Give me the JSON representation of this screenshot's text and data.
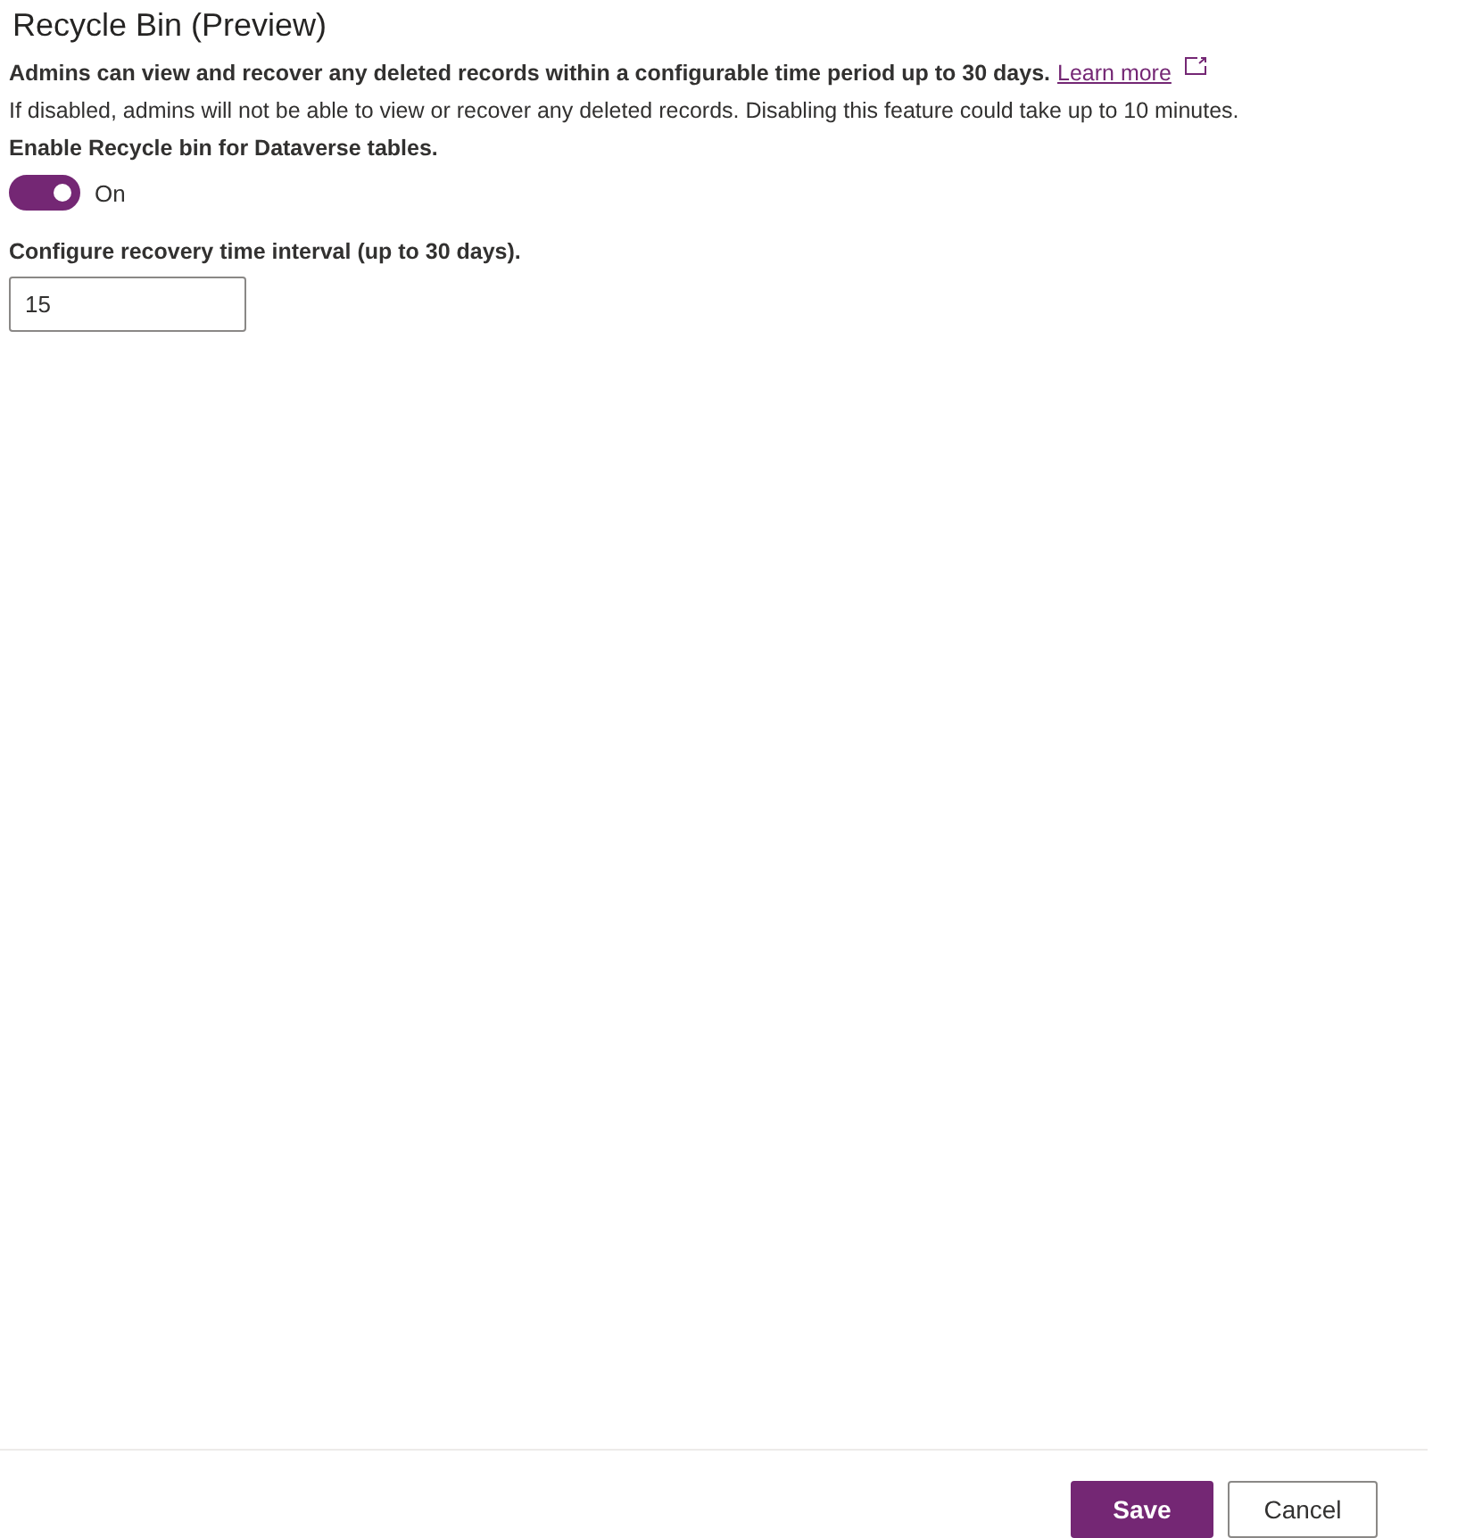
{
  "title": "Recycle Bin (Preview)",
  "description": "Admins can view and recover any deleted records within a configurable time period up to 30 days.",
  "learn_more": "Learn more",
  "note": "If disabled, admins will not be able to view or recover any deleted records. Disabling this feature could take up to 10 minutes.",
  "toggle": {
    "label": "Enable Recycle bin for Dataverse tables.",
    "on": true,
    "state_text": "On"
  },
  "interval": {
    "label": "Configure recovery time interval (up to 30 days).",
    "value": "15"
  },
  "buttons": [
    {
      "label": "Save",
      "kind": "primary"
    },
    {
      "label": "Cancel",
      "kind": "secondary"
    }
  ]
}
